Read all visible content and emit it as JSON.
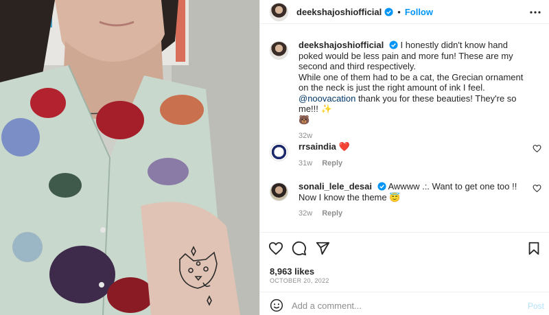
{
  "header": {
    "username": "deekshajoshiofficial",
    "separator": "•",
    "follow_label": "Follow",
    "avatar_icon": "user-avatar",
    "verified_icon": "verified-badge-icon",
    "more_icon": "more-options-icon"
  },
  "caption": {
    "username": "deekshajoshiofficial",
    "text_1": "I honestly didn't know hand poked would be less pain and more fun! These are my second and third respectively.",
    "text_2": "While one of them had to be a cat, the Grecian ornament on the neck is just the right amount of ink I feel.",
    "mention": "@noovacation",
    "text_3": "thank you for these beauties! They're so me!!! ✨",
    "emoji_line": "🐻",
    "time": "32w"
  },
  "comments": [
    {
      "username": "rrsaindia",
      "text": "❤️",
      "time": "31w",
      "reply_label": "Reply"
    },
    {
      "username": "sonali_lele_desai",
      "text": "Awwww .:. Want to get one too !! Now I know the theme 😇",
      "time": "32w",
      "reply_label": "Reply"
    }
  ],
  "actions": {
    "like_icon": "heart-icon",
    "comment_icon": "comment-icon",
    "share_icon": "share-icon",
    "save_icon": "bookmark-icon"
  },
  "likes": "8,963 likes",
  "date": "OCTOBER 20, 2022",
  "add_comment": {
    "placeholder": "Add a comment...",
    "post_label": "Post",
    "emoji_icon": "emoji-icon"
  },
  "colors": {
    "link_blue": "#0095f6",
    "text": "#262626",
    "muted": "#8e8e8e",
    "heart_red": "#ed4956"
  }
}
